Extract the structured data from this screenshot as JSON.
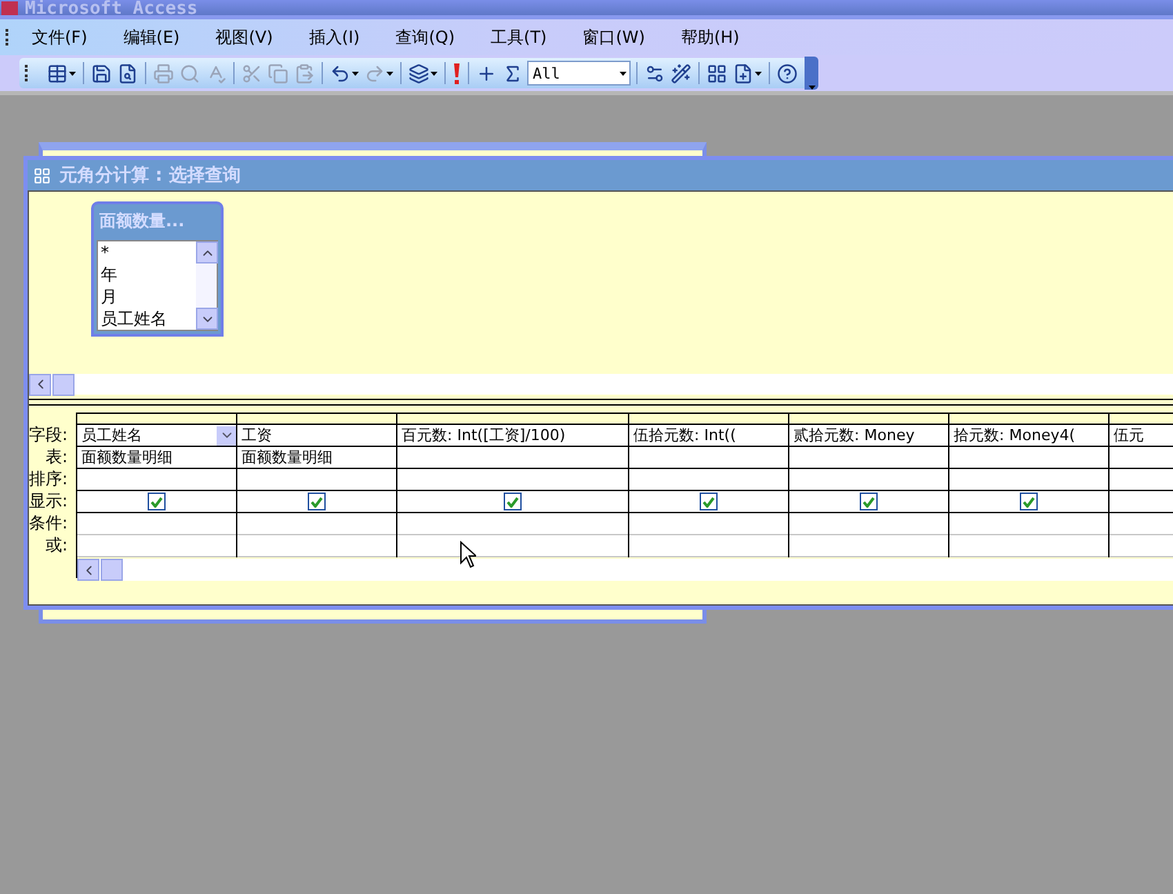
{
  "app": {
    "title": "Microsoft Access"
  },
  "menu": [
    {
      "label": "文件(F)"
    },
    {
      "label": "编辑(E)"
    },
    {
      "label": "视图(V)"
    },
    {
      "label": "插入(I)"
    },
    {
      "label": "查询(Q)"
    },
    {
      "label": "工具(T)"
    },
    {
      "label": "窗口(W)"
    },
    {
      "label": "帮助(H)"
    }
  ],
  "toolbar": [
    {
      "kind": "button",
      "disabled": false,
      "dropdown": true
    },
    {
      "kind": "separator"
    },
    {
      "kind": "button",
      "disabled": false
    },
    {
      "kind": "button",
      "disabled": false
    },
    {
      "kind": "separator"
    },
    {
      "kind": "button",
      "disabled": true
    },
    {
      "kind": "button",
      "disabled": true
    },
    {
      "kind": "button",
      "disabled": true
    },
    {
      "kind": "separator"
    },
    {
      "kind": "button",
      "disabled": true
    },
    {
      "kind": "button",
      "disabled": true
    },
    {
      "kind": "button",
      "disabled": true
    },
    {
      "kind": "separator"
    },
    {
      "kind": "button",
      "disabled": false,
      "dropdown": true
    },
    {
      "kind": "button",
      "disabled": true,
      "dropdown": true
    },
    {
      "kind": "separator"
    },
    {
      "kind": "button",
      "disabled": false,
      "dropdown": true
    },
    {
      "kind": "separator"
    },
    {
      "kind": "button",
      "disabled": false
    },
    {
      "kind": "separator"
    },
    {
      "kind": "button",
      "disabled": false
    },
    {
      "kind": "button",
      "disabled": false
    },
    {
      "kind": "combo",
      "value": "All"
    },
    {
      "kind": "separator"
    },
    {
      "kind": "button",
      "disabled": false
    },
    {
      "kind": "button",
      "disabled": false
    },
    {
      "kind": "separator"
    },
    {
      "kind": "button",
      "disabled": false
    },
    {
      "kind": "button",
      "disabled": false,
      "dropdown": true
    },
    {
      "kind": "separator"
    },
    {
      "kind": "button",
      "disabled": false
    }
  ],
  "query_window": {
    "title": "元角分计算 : 选择查询",
    "field_list": {
      "title": "面额数量...",
      "items": [
        "*",
        "年",
        "月",
        "员工姓名"
      ]
    },
    "row_labels": [
      "字段:",
      "表:",
      "排序:",
      "显示:",
      "条件:",
      "或:"
    ],
    "columns": [
      {
        "field": "员工姓名",
        "table": "面额数量明细",
        "show": true,
        "dropdown": true
      },
      {
        "field": "工资",
        "table": "面额数量明细",
        "show": true
      },
      {
        "field": "百元数: Int([工资]/100)",
        "show": true
      },
      {
        "field": "伍拾元数: Int((",
        "show": true
      },
      {
        "field": "贰拾元数: Money",
        "show": true
      },
      {
        "field": "拾元数: Money4(",
        "show": true
      },
      {
        "field": "伍元"
      }
    ]
  }
}
